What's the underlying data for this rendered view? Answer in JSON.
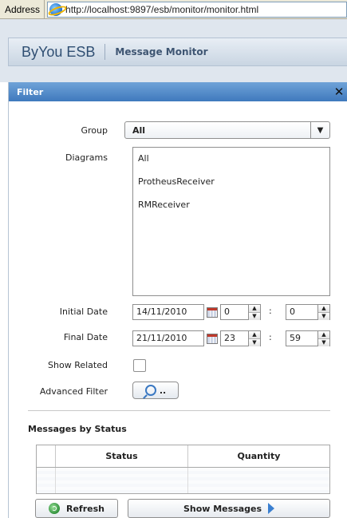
{
  "browser": {
    "address_label": "Address",
    "url": "http://localhost:9897/esb/monitor/monitor.html"
  },
  "header": {
    "brand": "ByYou ESB",
    "subtitle": "Message Monitor"
  },
  "filter": {
    "title": "Filter",
    "close": "✕",
    "group_label": "Group",
    "group_value": "All",
    "diagrams_label": "Diagrams",
    "diagrams": [
      "All",
      "ProtheusReceiver",
      "RMReceiver"
    ],
    "initial_date_label": "Initial Date",
    "initial_date": "14/11/2010",
    "initial_hour": "0",
    "initial_minute": "0",
    "final_date_label": "Final Date",
    "final_date": "21/11/2010",
    "final_hour": "23",
    "final_minute": "59",
    "time_separator": ":",
    "show_related_label": "Show Related",
    "show_related_checked": false,
    "advanced_filter_label": "Advanced Filter",
    "advanced_filter_button": ".."
  },
  "status_section": {
    "title": "Messages by Status",
    "columns": [
      "",
      "Status",
      "Quantity"
    ],
    "rows": []
  },
  "actions": {
    "refresh": "Refresh",
    "show_messages": "Show Messages"
  },
  "icons": [
    "ie-page-icon",
    "close-icon",
    "chevron-down-icon",
    "calendar-icon",
    "search-icon",
    "refresh-icon",
    "arrow-right-icon"
  ]
}
